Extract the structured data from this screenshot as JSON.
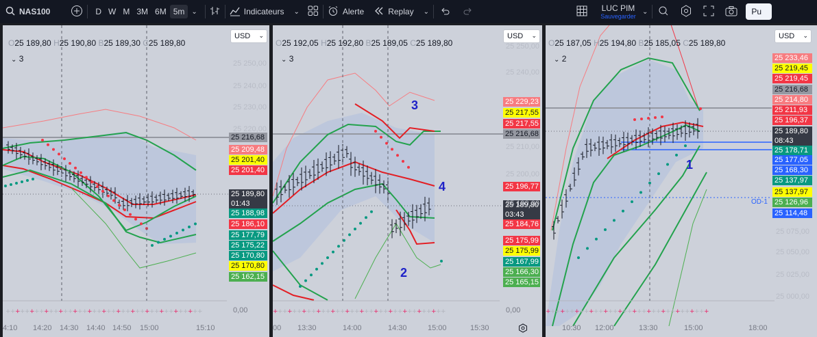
{
  "toolbar": {
    "symbol": "NAS100",
    "intervals": [
      "D",
      "W",
      "M",
      "3M",
      "6M",
      "5m"
    ],
    "indicators_label": "Indicateurs",
    "alert_label": "Alerte",
    "replay_label": "Replay",
    "layout_name": "LUC PIM",
    "layout_status": "Sauvegarder",
    "publish_label": "Pu"
  },
  "panes": [
    {
      "ohlc": {
        "o": "25 189,80",
        "h": "25 190,80",
        "b": "25 189,30",
        "c": "25 189,80"
      },
      "legend_count": "3",
      "currency": "USD",
      "axis_labels": [
        "25 250,00",
        "25 240,00",
        "25 230,00",
        "25 220,00"
      ],
      "price_tags": [
        {
          "text": "25 216,68",
          "bg": "#9598a1",
          "fg": "#131722"
        },
        {
          "text": "25 209,48",
          "bg": "#f77c80",
          "fg": "#ffffff"
        },
        {
          "text": "25 201,40",
          "bg": "#ffff00",
          "fg": "#131722"
        },
        {
          "text": "25 201,40",
          "bg": "#f23645",
          "fg": "#ffffff"
        },
        {
          "text": "25 189,80",
          "bg": "#363a45",
          "fg": "#ffffff"
        },
        {
          "text": "01:43",
          "bg": "#363a45",
          "fg": "#ffffff"
        },
        {
          "text": "25 188,98",
          "bg": "#089981",
          "fg": "#ffffff"
        },
        {
          "text": "25 186,10",
          "bg": "#f23645",
          "fg": "#ffffff"
        },
        {
          "text": "25 177,79",
          "bg": "#089981",
          "fg": "#ffffff"
        },
        {
          "text": "25 175,22",
          "bg": "#089981",
          "fg": "#ffffff"
        },
        {
          "text": "25 170,80",
          "bg": "#089981",
          "fg": "#ffffff"
        },
        {
          "text": "25 170,80",
          "bg": "#ffff00",
          "fg": "#131722"
        },
        {
          "text": "25 162,15",
          "bg": "#4caf50",
          "fg": "#ffffff"
        }
      ],
      "times": [
        "4:10",
        "14:20",
        "14:30",
        "14:40",
        "14:50",
        "15:00",
        "15:10"
      ],
      "zero_label": "0,00"
    },
    {
      "ohlc": {
        "o": "25 192,05",
        "h": "25 192,80",
        "b": "25 189,05",
        "c": "25 189,80"
      },
      "legend_count": "3",
      "currency": "USD",
      "axis_labels": [
        "25 250,00",
        "25 240,00",
        "25 210,00",
        "25 200,00",
        "25 190,00"
      ],
      "price_tags": [
        {
          "text": "25 229,23",
          "bg": "#f77c80",
          "fg": "#ffffff"
        },
        {
          "text": "25 217,55",
          "bg": "#ffff00",
          "fg": "#131722"
        },
        {
          "text": "25 217,55",
          "bg": "#f23645",
          "fg": "#ffffff"
        },
        {
          "text": "25 216,68",
          "bg": "#9598a1",
          "fg": "#131722"
        },
        {
          "text": "25 196,77",
          "bg": "#f23645",
          "fg": "#ffffff"
        },
        {
          "text": "25 189,80",
          "bg": "#363a45",
          "fg": "#ffffff"
        },
        {
          "text": "03:43",
          "bg": "#363a45",
          "fg": "#ffffff"
        },
        {
          "text": "25 184,76",
          "bg": "#f23645",
          "fg": "#ffffff"
        },
        {
          "text": "25 175,99",
          "bg": "#f23645",
          "fg": "#ffffff"
        },
        {
          "text": "25 175,99",
          "bg": "#ffff00",
          "fg": "#131722"
        },
        {
          "text": "25 167,99",
          "bg": "#089981",
          "fg": "#ffffff"
        },
        {
          "text": "25 166,30",
          "bg": "#4caf50",
          "fg": "#ffffff"
        },
        {
          "text": "25 165,15",
          "bg": "#4caf50",
          "fg": "#ffffff"
        }
      ],
      "times": [
        "00",
        "13:30",
        "14:00",
        "14:30",
        "15:00",
        "15:30"
      ],
      "annotations": [
        "3",
        "4",
        "2"
      ],
      "zero_label": "0,00"
    },
    {
      "ohlc": {
        "o": "25 187,05",
        "h": "25 194,80",
        "b": "25 185,05",
        "c": "25 189,80"
      },
      "legend_count": "2",
      "currency": "USD",
      "axis_labels": [
        "25 075,00",
        "25 050,00",
        "25 025,00",
        "25 000,00"
      ],
      "price_tags": [
        {
          "text": "25 233,46",
          "bg": "#f77c80",
          "fg": "#ffffff"
        },
        {
          "text": "25 219,45",
          "bg": "#ffff00",
          "fg": "#131722"
        },
        {
          "text": "25 219,45",
          "bg": "#f23645",
          "fg": "#ffffff"
        },
        {
          "text": "25 216,68",
          "bg": "#9598a1",
          "fg": "#131722"
        },
        {
          "text": "25 214,80",
          "bg": "#f77c80",
          "fg": "#ffffff"
        },
        {
          "text": "25 211,93",
          "bg": "#f23645",
          "fg": "#ffffff"
        },
        {
          "text": "25 196,37",
          "bg": "#f23645",
          "fg": "#ffffff"
        },
        {
          "text": "25 189,80",
          "bg": "#363a45",
          "fg": "#ffffff"
        },
        {
          "text": "08:43",
          "bg": "#363a45",
          "fg": "#ffffff"
        },
        {
          "text": "25 178,71",
          "bg": "#089981",
          "fg": "#ffffff"
        },
        {
          "text": "25 177,05",
          "bg": "#2962ff",
          "fg": "#ffffff"
        },
        {
          "text": "25 168,30",
          "bg": "#2962ff",
          "fg": "#ffffff"
        },
        {
          "text": "25 137,97",
          "bg": "#089981",
          "fg": "#ffffff"
        },
        {
          "text": "25 137,97",
          "bg": "#ffff00",
          "fg": "#131722"
        },
        {
          "text": "25 126,96",
          "bg": "#4caf50",
          "fg": "#ffffff"
        },
        {
          "text": "25 114,48",
          "bg": "#2962ff",
          "fg": "#ffffff"
        }
      ],
      "od_label": "OD-1",
      "times": [
        "10:30",
        "12:00",
        "13:30",
        "15:00",
        "18:00"
      ],
      "annotations": [
        "1"
      ]
    }
  ]
}
